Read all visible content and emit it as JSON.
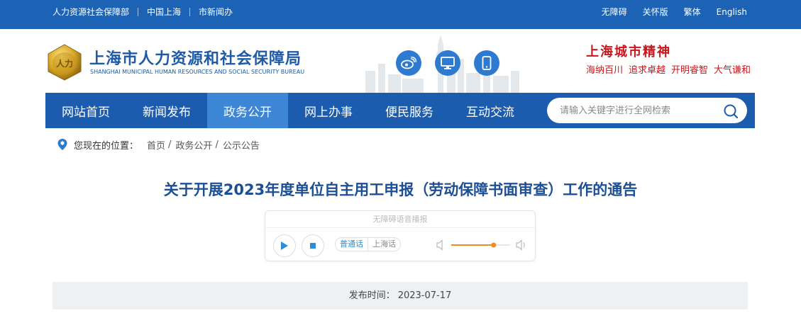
{
  "topbar": {
    "links": [
      "人力资源社会保障部",
      "中国上海",
      "市新闻办"
    ],
    "right_links": [
      "无障碍",
      "关怀版",
      "繁体",
      "English"
    ]
  },
  "header": {
    "title": "上海市人力资源和社会保障局",
    "subtitle": "SHANGHAI MUNICIPAL HUMAN RESOURCES AND SOCIAL SECURITY BUREAU",
    "logo_text": "人力",
    "spirit_title": "上海城市精神",
    "spirit_words": [
      "海纳百川",
      "追求卓越",
      "开明睿智",
      "大气谦和"
    ]
  },
  "nav": {
    "items": [
      "网站首页",
      "新闻发布",
      "政务公开",
      "网上办事",
      "便民服务",
      "互动交流"
    ],
    "active_index": 2
  },
  "search": {
    "placeholder": "请输入关键字进行全网检索"
  },
  "breadcrumb": {
    "label": "您现在的位置：",
    "crumbs": [
      "首页",
      "政务公开",
      "公示公告"
    ]
  },
  "article": {
    "title": "关于开展2023年度单位自主用工申报（劳动保障书面审查）工作的通告",
    "player": {
      "title": "无障碍语音播报",
      "lang_on": "普通话",
      "lang_off": "上海话",
      "volume_fraction": 0.72
    },
    "meta_label": "发布时间：",
    "publish_date": "2023-07-17"
  },
  "colors": {
    "brand_blue": "#1c63b6",
    "nav_blue": "#1c5cae",
    "nav_active": "#3d86d5",
    "title_blue": "#1c4f96",
    "spirit_red": "#c8161d",
    "volume_orange": "#f08a24"
  },
  "icons": [
    "weibo-icon",
    "desktop-icon",
    "mobile-icon",
    "search-icon",
    "location-pin-icon",
    "play-icon",
    "stop-icon",
    "volume-low-icon",
    "volume-high-icon"
  ]
}
